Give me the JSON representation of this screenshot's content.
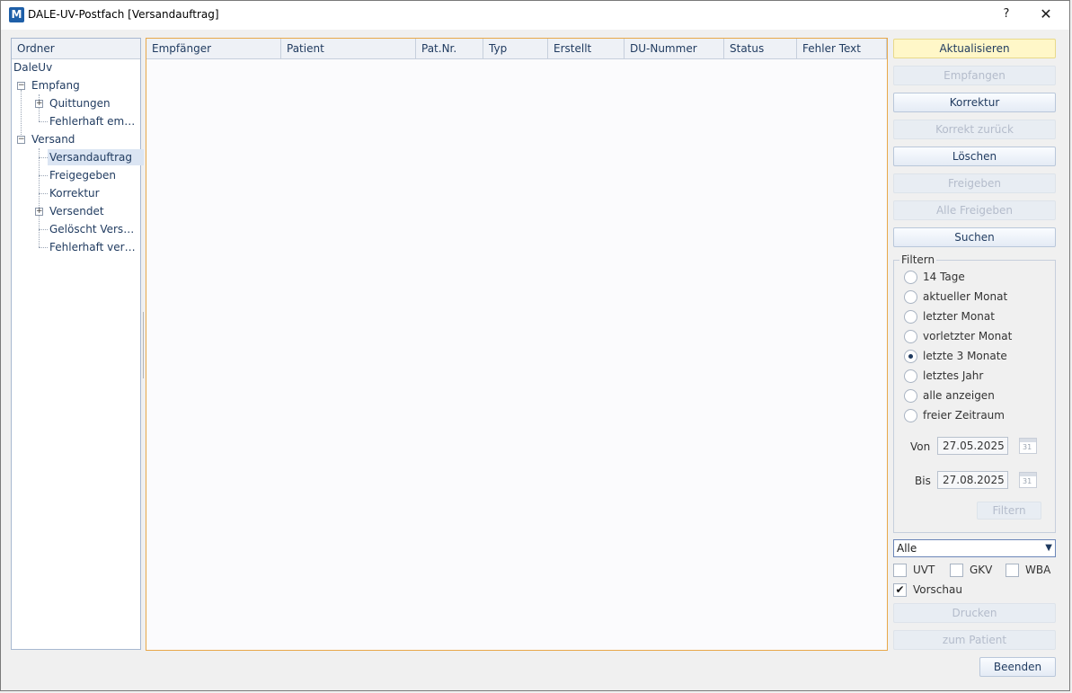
{
  "window": {
    "title": "DALE-UV-Postfach  [Versandauftrag]",
    "help": "?",
    "close": "✕",
    "icon_letter": "M"
  },
  "tree": {
    "header": "Ordner",
    "root": "DaleUv",
    "nodes": [
      "Empfang",
      "Quittungen",
      "Fehlerhaft empfangen",
      "Versand",
      "Versandauftrag",
      "Freigegeben",
      "Korrektur",
      "Versendet",
      "Gelöscht Versandauftrag",
      "Fehlerhaft versendet"
    ],
    "expand_collapsed": "+",
    "expand_open": "−"
  },
  "grid": {
    "columns": [
      "Empfänger",
      "Patient",
      "Pat.Nr.",
      "Typ",
      "Erstellt",
      "DU-Nummer",
      "Status",
      "Fehler Text"
    ],
    "rows": []
  },
  "buttons": {
    "aktualisieren": "Aktualisieren",
    "empfangen": "Empfangen",
    "korrektur": "Korrektur",
    "korrekt_zurueck": "Korrekt zurück",
    "loeschen": "Löschen",
    "freigeben": "Freigeben",
    "alle_freigeben": "Alle Freigeben",
    "suchen": "Suchen",
    "filtern": "Filtern",
    "drucken": "Drucken",
    "zum_patient": "zum Patient",
    "beenden": "Beenden"
  },
  "filter": {
    "legend": "Filtern",
    "options": [
      "14 Tage",
      "aktueller Monat",
      "letzter Monat",
      "vorletzter Monat",
      "letzte 3 Monate",
      "letztes Jahr",
      "alle anzeigen",
      "freier Zeitraum"
    ],
    "selected": "letzte 3 Monate",
    "von_label": "Von",
    "von": "27.05.2025",
    "bis_label": "Bis",
    "bis": "27.08.2025",
    "calendar_day": "31"
  },
  "dropdown": {
    "value": "Alle"
  },
  "checkboxes": {
    "uvt": {
      "label": "UVT",
      "checked": false
    },
    "gkv": {
      "label": "GKV",
      "checked": false
    },
    "wba": {
      "label": "WBA",
      "checked": false
    },
    "vorschau": {
      "label": "Vorschau",
      "checked": true
    }
  },
  "icons": {
    "calendar": "calendar-icon",
    "app": "app-logo-icon",
    "dropdown": "chevron-down-icon"
  },
  "colors": {
    "grid_border": "#e8a84a",
    "highlight_button": "#fff7c8",
    "tree_selected": "#dbe5f3"
  }
}
